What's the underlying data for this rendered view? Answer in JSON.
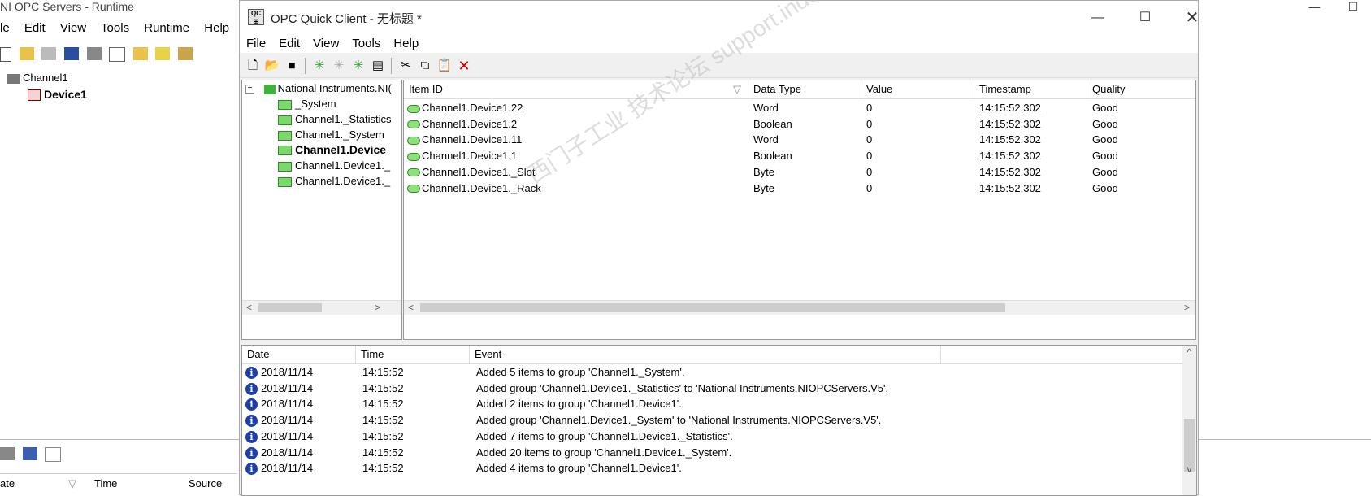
{
  "background_window": {
    "title": "NI OPC Servers - Runtime",
    "menu": [
      "le",
      "Edit",
      "View",
      "Tools",
      "Runtime",
      "Help"
    ],
    "tree": [
      {
        "label": "Channel1",
        "bold": false
      },
      {
        "label": "Device1",
        "bold": true
      }
    ],
    "log_columns": [
      "ate",
      "Time",
      "Source"
    ]
  },
  "dialog": {
    "title": "OPC Quick Client - 无标题 *",
    "menu": [
      "File",
      "Edit",
      "View",
      "Tools",
      "Help"
    ],
    "tree": {
      "root": "National Instruments.NI(",
      "children": [
        {
          "label": "_System",
          "bold": false
        },
        {
          "label": "Channel1._Statistics",
          "bold": false
        },
        {
          "label": "Channel1._System",
          "bold": false
        },
        {
          "label": "Channel1.Device",
          "bold": true
        },
        {
          "label": "Channel1.Device1._",
          "bold": false
        },
        {
          "label": "Channel1.Device1._",
          "bold": false
        }
      ]
    },
    "items_table": {
      "columns": [
        "Item ID",
        "Data Type",
        "Value",
        "Timestamp",
        "Quality"
      ],
      "rows": [
        [
          "Channel1.Device1.22",
          "Word",
          "0",
          "14:15:52.302",
          "Good"
        ],
        [
          "Channel1.Device1.2",
          "Boolean",
          "0",
          "14:15:52.302",
          "Good"
        ],
        [
          "Channel1.Device1.11",
          "Word",
          "0",
          "14:15:52.302",
          "Good"
        ],
        [
          "Channel1.Device1.1",
          "Boolean",
          "0",
          "14:15:52.302",
          "Good"
        ],
        [
          "Channel1.Device1._Slot",
          "Byte",
          "0",
          "14:15:52.302",
          "Good"
        ],
        [
          "Channel1.Device1._Rack",
          "Byte",
          "0",
          "14:15:52.302",
          "Good"
        ]
      ]
    },
    "event_log": {
      "columns": [
        "Date",
        "Time",
        "Event"
      ],
      "rows": [
        [
          "2018/11/14",
          "14:15:52",
          "Added 5 items to group 'Channel1._System'."
        ],
        [
          "2018/11/14",
          "14:15:52",
          "Added group 'Channel1.Device1._Statistics' to 'National Instruments.NIOPCServers.V5'."
        ],
        [
          "2018/11/14",
          "14:15:52",
          "Added 2 items to group 'Channel1.Device1'."
        ],
        [
          "2018/11/14",
          "14:15:52",
          "Added group 'Channel1.Device1._System' to 'National Instruments.NIOPCServers.V5'."
        ],
        [
          "2018/11/14",
          "14:15:52",
          "Added 7 items to group 'Channel1.Device1._Statistics'."
        ],
        [
          "2018/11/14",
          "14:15:52",
          "Added 20 items to group 'Channel1.Device1._System'."
        ],
        [
          "2018/11/14",
          "14:15:52",
          "Added 4 items to group 'Channel1.Device1'."
        ]
      ]
    }
  },
  "watermark": "西门子工业 技术论坛 support.industry.siemens.com/cs"
}
